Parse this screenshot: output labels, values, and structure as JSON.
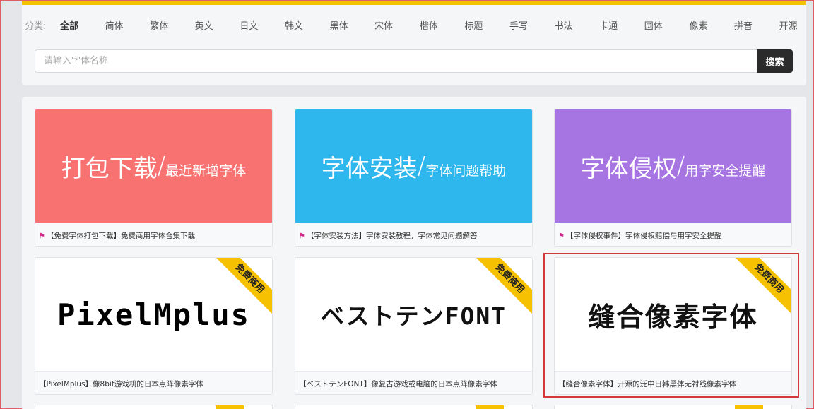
{
  "categories": {
    "label": "分类:",
    "items": [
      "全部",
      "简体",
      "繁体",
      "英文",
      "日文",
      "韩文",
      "黑体",
      "宋体",
      "楷体",
      "标题",
      "手写",
      "书法",
      "卡通",
      "圆体",
      "像素",
      "拼音",
      "开源"
    ],
    "active_index": 0
  },
  "search": {
    "placeholder": "请输入字体名称",
    "value": "",
    "button_label": "搜索"
  },
  "colors": {
    "accent": "#f6c100",
    "card_red": "#f97272",
    "card_blue": "#2db7ed",
    "card_purple": "#a775e2",
    "flag": "#d6248f",
    "highlight": "#d23a3a"
  },
  "cards": [
    {
      "title_big": "打包下载",
      "title_small": "最近新增字体",
      "caption": "【免费字体打包下载】免费商用字体合集下载",
      "flag_icon": "flag-icon"
    },
    {
      "title_big": "字体安装",
      "title_small": "字体问题帮助",
      "caption": "【字体安装方法】字体安装教程，字体常见问题解答",
      "flag_icon": "flag-icon"
    },
    {
      "title_big": "字体侵权",
      "title_small": "用字安全提醒",
      "caption": "【字体侵权事件】字体侵权赔偿与用字安全提醒",
      "flag_icon": "flag-icon"
    },
    {
      "preview": "PixelMplus",
      "ribbon": "免费商用",
      "caption": "【PixelMplus】像8bit游戏机的日本点阵像素字体"
    },
    {
      "preview": "ベストテンFONT",
      "ribbon": "免费商用",
      "caption": "【ベストテンFONT】像复古游戏或电脑的日本点阵像素字体"
    },
    {
      "preview": "缝合像素字体",
      "ribbon": "免费商用",
      "caption": "【缝合像素字体】开源的泛中日韩黑体无衬线像素字体"
    }
  ]
}
